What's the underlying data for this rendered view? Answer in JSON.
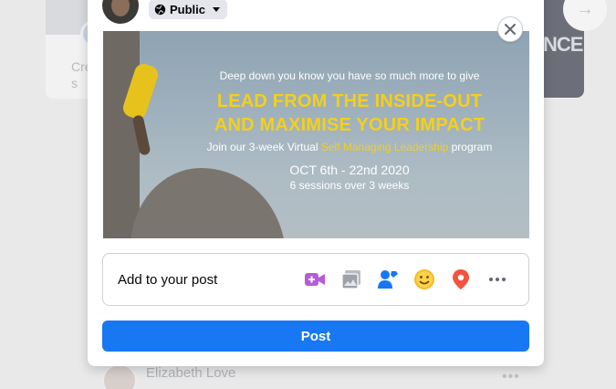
{
  "background": {
    "create_story_text": "Cre\ns",
    "story_right_text": "NCER",
    "author_name": "Elizabeth Love",
    "more_dots": "•••",
    "arrow_glyph": "→"
  },
  "composer": {
    "privacy_label": "Public",
    "banner": {
      "subtitle": "Deep down you know you have so much more to give",
      "headline_1": "LEAD FROM THE INSIDE-OUT",
      "headline_2": "AND MAXIMISE YOUR IMPACT",
      "join_prefix": "Join our 3-week Virtual ",
      "join_highlight": "Self Managing Leadership",
      "join_suffix": " program",
      "date": "OCT 6th - 22nd 2020",
      "sessions": "6 sessions over 3 weeks"
    },
    "add_to_post_label": "Add to your post",
    "add_icons": [
      {
        "name": "live-video-icon",
        "color": "#b45cd9"
      },
      {
        "name": "photo-icon",
        "color": "#9ea2a8"
      },
      {
        "name": "tag-people-icon",
        "color": "#1877f2"
      },
      {
        "name": "feeling-icon",
        "color": "#f7b928"
      },
      {
        "name": "check-in-icon",
        "color": "#f5533d"
      },
      {
        "name": "more-icon",
        "color": "#606770"
      }
    ],
    "post_button_label": "Post"
  },
  "colors": {
    "accent": "#1877f2",
    "banner_highlight": "#f4cf1d"
  }
}
